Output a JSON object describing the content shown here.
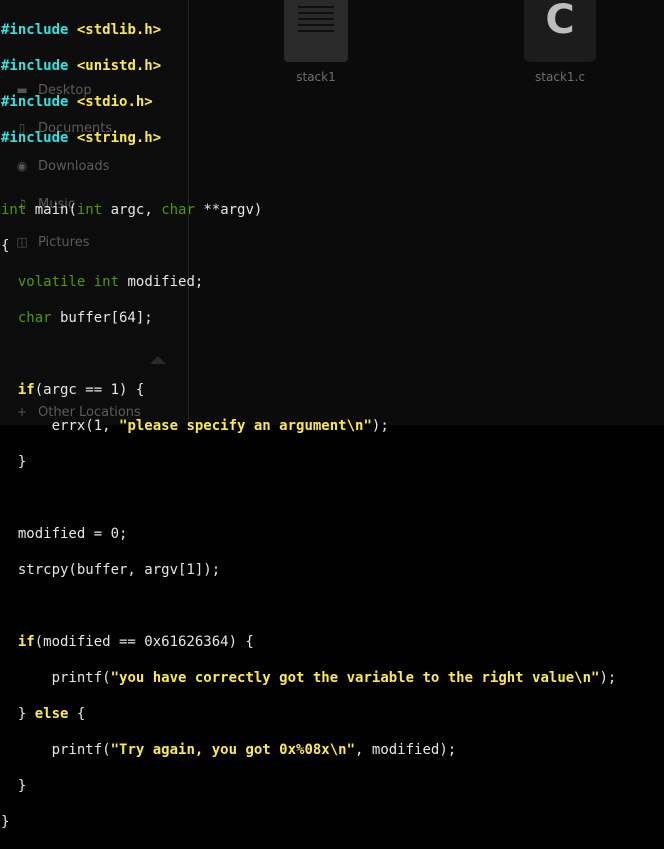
{
  "sidebar": {
    "items": [
      {
        "label": "Desktop",
        "icon": "desktop-icon"
      },
      {
        "label": "Documents",
        "icon": "document-icon"
      },
      {
        "label": "Downloads",
        "icon": "download-icon"
      },
      {
        "label": "Music",
        "icon": "music-icon"
      },
      {
        "label": "Pictures",
        "icon": "picture-icon"
      },
      {
        "label": "Other Locations",
        "icon": "plus-icon"
      }
    ]
  },
  "files": [
    {
      "name": "stack1",
      "icon": "binary-file-icon"
    },
    {
      "name": "stack1.c",
      "icon": "c-source-file-icon",
      "badge": "C"
    }
  ],
  "code": {
    "include1": "#include",
    "header1": "<stdlib.h>",
    "include2": "#include",
    "header2": "<unistd.h>",
    "include3": "#include",
    "header3": "<stdio.h>",
    "include4": "#include",
    "header4": "<string.h>",
    "main_int": "int",
    "main_a": " main(",
    "main_int2": "int",
    "main_b": " argc, ",
    "main_char": "char",
    "main_c": " **argv)",
    "brace_open": "{",
    "decl1_kw1": "volatile",
    "decl1_sp": " ",
    "decl1_kw2": "int",
    "decl1_rest": " modified;",
    "decl2_kw": "char",
    "decl2_rest": " buffer[64];",
    "if1_kw": "if",
    "if1_rest": "(argc == 1) {",
    "errx_a": "errx(1, ",
    "errx_str": "\"please specify an argument\\n\"",
    "errx_b": ");",
    "close1": "}",
    "assign": "modified = 0;",
    "strcpy": "strcpy(buffer, argv[1]);",
    "if2_kw": "if",
    "if2_rest": "(modified == 0x61626364) {",
    "printf1_a": "printf(",
    "printf1_str": "\"you have correctly got the variable to the right value\\n\"",
    "printf1_b": ");",
    "else_a": "} ",
    "else_kw": "else",
    "else_b": " {",
    "printf2_a": "printf(",
    "printf2_str": "\"Try again, you got 0x%08x\\n\"",
    "printf2_b": ", modified);",
    "close2": "}",
    "brace_close": "}"
  }
}
